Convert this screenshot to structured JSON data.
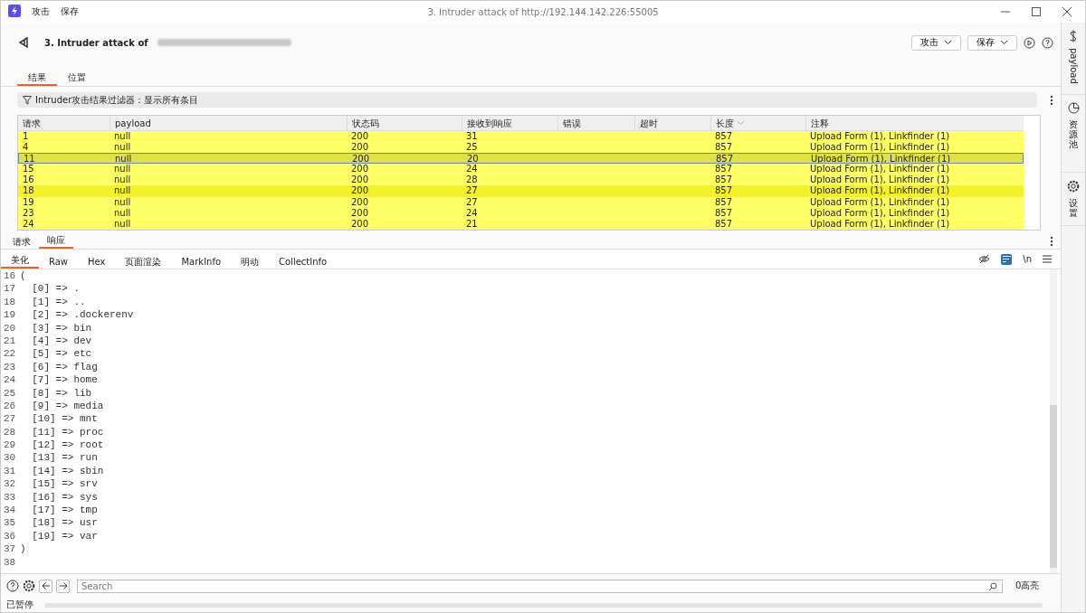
{
  "window": {
    "menu": [
      "攻击",
      "保存"
    ],
    "title": "3. Intruder attack of http://192.144.142.226:55005"
  },
  "header": {
    "title": "3. Intruder attack of",
    "buttons": [
      "攻击",
      "保存"
    ]
  },
  "tabs": [
    {
      "label": "结果",
      "selected": true
    },
    {
      "label": "位置",
      "selected": false
    }
  ],
  "filter": {
    "label": "Intruder攻击结果过滤器：显示所有条目"
  },
  "table": {
    "columns": [
      "请求",
      "payload",
      "状态码",
      "接收到响应",
      "错误",
      "超时",
      "长度",
      "注释"
    ],
    "rows": [
      {
        "cells": [
          "1",
          "null",
          "200",
          "31",
          "",
          "",
          "857",
          "Upload Form (1), Linkfinder (1)"
        ],
        "selected": false,
        "color": "#ffff66"
      },
      {
        "cells": [
          "4",
          "null",
          "200",
          "25",
          "",
          "",
          "857",
          "Upload Form (1), Linkfinder (1)"
        ],
        "selected": false,
        "color": "#ffff66"
      },
      {
        "cells": [
          "11",
          "null",
          "200",
          "20",
          "",
          "",
          "857",
          "Upload Form (1), Linkfinder (1)"
        ],
        "selected": true,
        "color": "#e0e04a"
      },
      {
        "cells": [
          "15",
          "null",
          "200",
          "24",
          "",
          "",
          "857",
          "Upload Form (1), Linkfinder (1)"
        ],
        "selected": false,
        "color": "#ffff66"
      },
      {
        "cells": [
          "16",
          "null",
          "200",
          "28",
          "",
          "",
          "857",
          "Upload Form (1), Linkfinder (1)"
        ],
        "selected": false,
        "color": "#ffff66"
      },
      {
        "cells": [
          "18",
          "null",
          "200",
          "27",
          "",
          "",
          "857",
          "Upload Form (1), Linkfinder (1)"
        ],
        "selected": false,
        "color": "#f3f22a"
      },
      {
        "cells": [
          "19",
          "null",
          "200",
          "27",
          "",
          "",
          "857",
          "Upload Form (1), Linkfinder (1)"
        ],
        "selected": false,
        "color": "#ffff66"
      },
      {
        "cells": [
          "23",
          "null",
          "200",
          "24",
          "",
          "",
          "857",
          "Upload Form (1), Linkfinder (1)"
        ],
        "selected": false,
        "color": "#ffff66"
      },
      {
        "cells": [
          "24",
          "null",
          "200",
          "21",
          "",
          "",
          "857",
          "Upload Form (1), Linkfinder (1)"
        ],
        "selected": false,
        "color": "#ffff66"
      }
    ]
  },
  "sub_tabs": [
    {
      "label": "请求",
      "selected": false
    },
    {
      "label": "响应",
      "selected": true
    }
  ],
  "view_tabs": [
    {
      "label": "美化",
      "selected": true
    },
    {
      "label": "Raw",
      "selected": false
    },
    {
      "label": "Hex",
      "selected": false
    },
    {
      "label": "页面渲染",
      "selected": false
    },
    {
      "label": "MarkInfo",
      "selected": false
    },
    {
      "label": "明动",
      "selected": false
    },
    {
      "label": "CollectInfo",
      "selected": false
    }
  ],
  "view_options": {
    "wrap_on": true,
    "newline_label": "\\n"
  },
  "code_lines": [
    {
      "num": "16",
      "text": "("
    },
    {
      "num": "17",
      "text": "  [0] => ."
    },
    {
      "num": "18",
      "text": "  [1] => .."
    },
    {
      "num": "19",
      "text": "  [2] => .dockerenv"
    },
    {
      "num": "20",
      "text": "  [3] => bin"
    },
    {
      "num": "21",
      "text": "  [4] => dev"
    },
    {
      "num": "22",
      "text": "  [5] => etc"
    },
    {
      "num": "23",
      "text": "  [6] => flag"
    },
    {
      "num": "24",
      "text": "  [7] => home"
    },
    {
      "num": "25",
      "text": "  [8] => lib"
    },
    {
      "num": "26",
      "text": "  [9] => media"
    },
    {
      "num": "27",
      "text": "  [10] => mnt"
    },
    {
      "num": "28",
      "text": "  [11] => proc"
    },
    {
      "num": "29",
      "text": "  [12] => root"
    },
    {
      "num": "30",
      "text": "  [13] => run"
    },
    {
      "num": "31",
      "text": "  [14] => sbin"
    },
    {
      "num": "32",
      "text": "  [15] => srv"
    },
    {
      "num": "33",
      "text": "  [16] => sys"
    },
    {
      "num": "34",
      "text": "  [17] => tmp"
    },
    {
      "num": "35",
      "text": "  [18] => usr"
    },
    {
      "num": "36",
      "text": "  [19] => var"
    },
    {
      "num": "37",
      "text": ")"
    },
    {
      "num": "38"
    }
  ],
  "search": {
    "placeholder": "Search",
    "matches": "0高亮"
  },
  "status": "已暂停",
  "progress": {
    "level": 0
  },
  "side_panel": [
    {
      "label": "payload",
      "kind": "dollar"
    },
    {
      "label": "资源池",
      "kind": "clock"
    },
    {
      "label": "设置",
      "kind": "gear"
    }
  ]
}
